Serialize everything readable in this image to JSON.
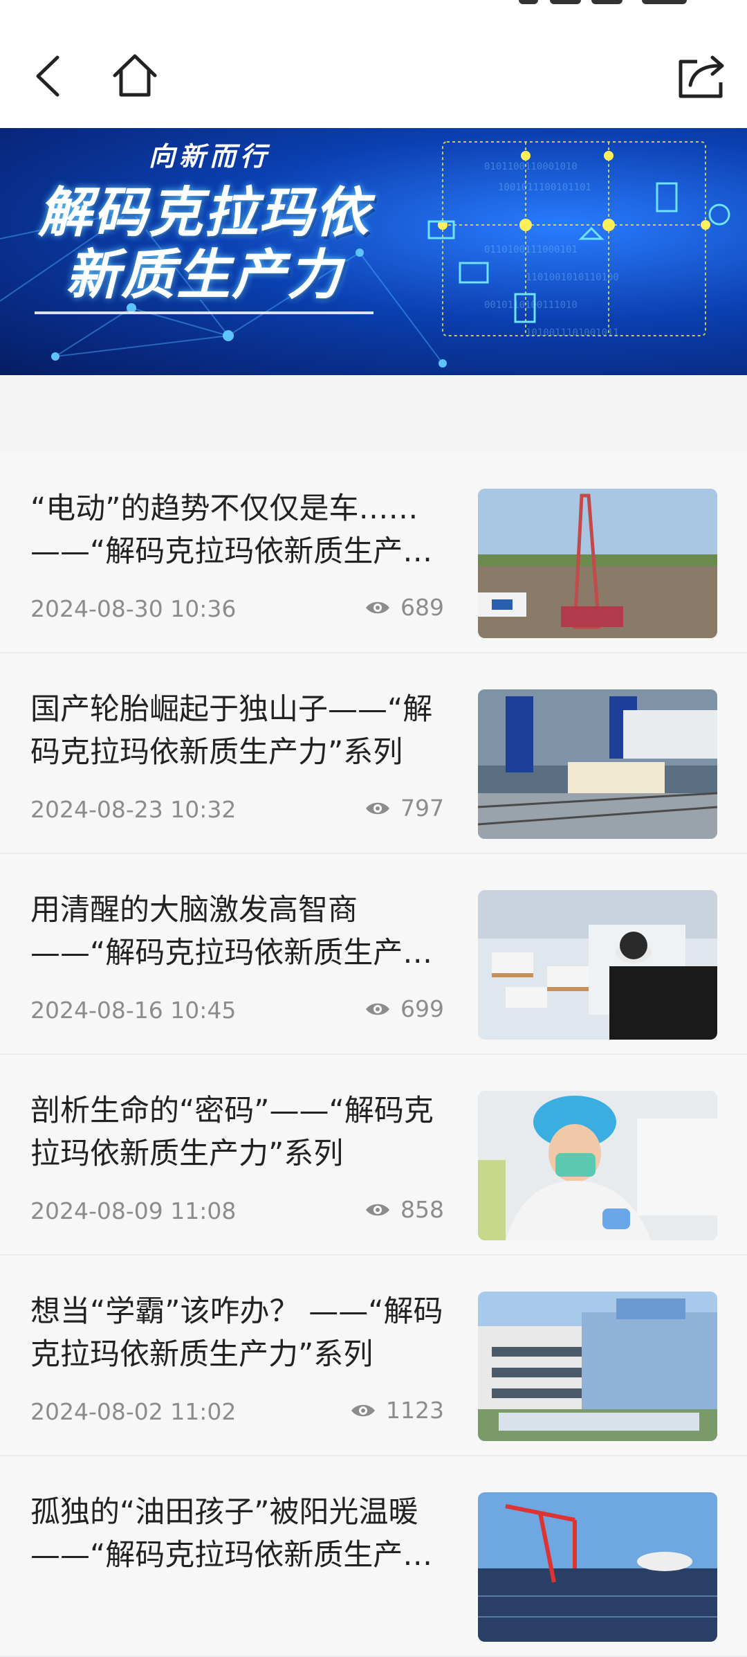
{
  "header": {
    "back_icon": "chevron-left-icon",
    "home_icon": "home-icon",
    "share_icon": "share-icon"
  },
  "banner": {
    "kicker": "向新而行",
    "title_line1": "解码克拉玛依",
    "title_line2": "新质生产力"
  },
  "articles": [
    {
      "title": "“电动”的趋势不仅仅是车……——“解码克拉玛依新质生产力”系列",
      "date": "2024-08-30 10:36",
      "views": "689"
    },
    {
      "title": "国产轮胎崛起于独山子——“解码克拉玛依新质生产力”系列",
      "date": "2024-08-23 10:32",
      "views": "797"
    },
    {
      "title": "用清醒的大脑激发高智商——“解码克拉玛依新质生产力”系列",
      "date": "2024-08-16 10:45",
      "views": "699"
    },
    {
      "title": "剖析生命的“密码”——“解码克拉玛依新质生产力”系列",
      "date": "2024-08-09 11:08",
      "views": "858"
    },
    {
      "title": "想当“学霸”该咋办？ ——“解码克拉玛依新质生产力”系列",
      "date": "2024-08-02 11:02",
      "views": "1123"
    },
    {
      "title": "孤独的“油田孩子”被阳光温暖——“解码克拉玛依新质生产力”系列",
      "date": "",
      "views": ""
    }
  ]
}
